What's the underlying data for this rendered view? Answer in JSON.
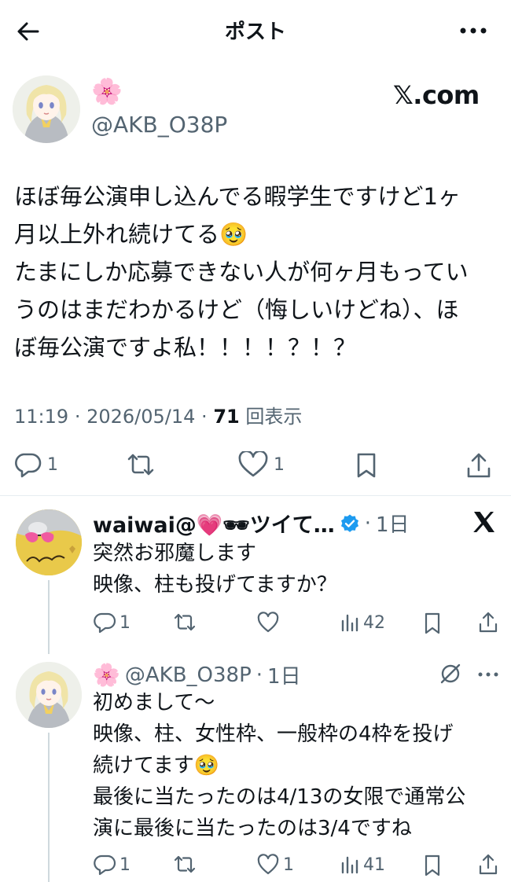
{
  "header": {
    "title": "ポスト"
  },
  "post": {
    "display_name": "🌸",
    "handle": "@AKB_O38P",
    "brand": "𝕏.com",
    "lines": [
      "ほぼ毎公演申し込んでる暇学生ですけど1ヶ",
      "月以上外れ続けてる🥹",
      "たまにしか応募できない人が何ヶ月もってい",
      "うのはまだわかるけど（悔しいけどね）、ほ",
      "ぼ毎公演ですよ私！！！！？！？"
    ],
    "time": "11:19",
    "date": "2026/05/14",
    "views": "71",
    "views_label": "回表示",
    "replies": "1",
    "likes": "1"
  },
  "replies": [
    {
      "display_name": "waiwai@💗🕶ツイて…",
      "time": "1日",
      "lines": [
        "突然お邪魔します",
        "映像、柱も投げてますか？"
      ],
      "replies": "1",
      "views": "42"
    },
    {
      "display_name": "🌸",
      "handle": "@AKB_O38P",
      "time": "1日",
      "lines": [
        "初めまして〜",
        "映像、柱、女性枠、一般枠の4枠を投げ",
        "続けてます🥹",
        "最後に当たったのは4/13の女限で通常公",
        "演に最後に当たったのは3/4ですね"
      ],
      "replies": "1",
      "likes": "1",
      "views": "41"
    }
  ],
  "colors": {
    "text": "#0f1419",
    "secondary": "#536471",
    "verified": "#1d9bf0",
    "heart_emoji": "#e63fa0"
  }
}
